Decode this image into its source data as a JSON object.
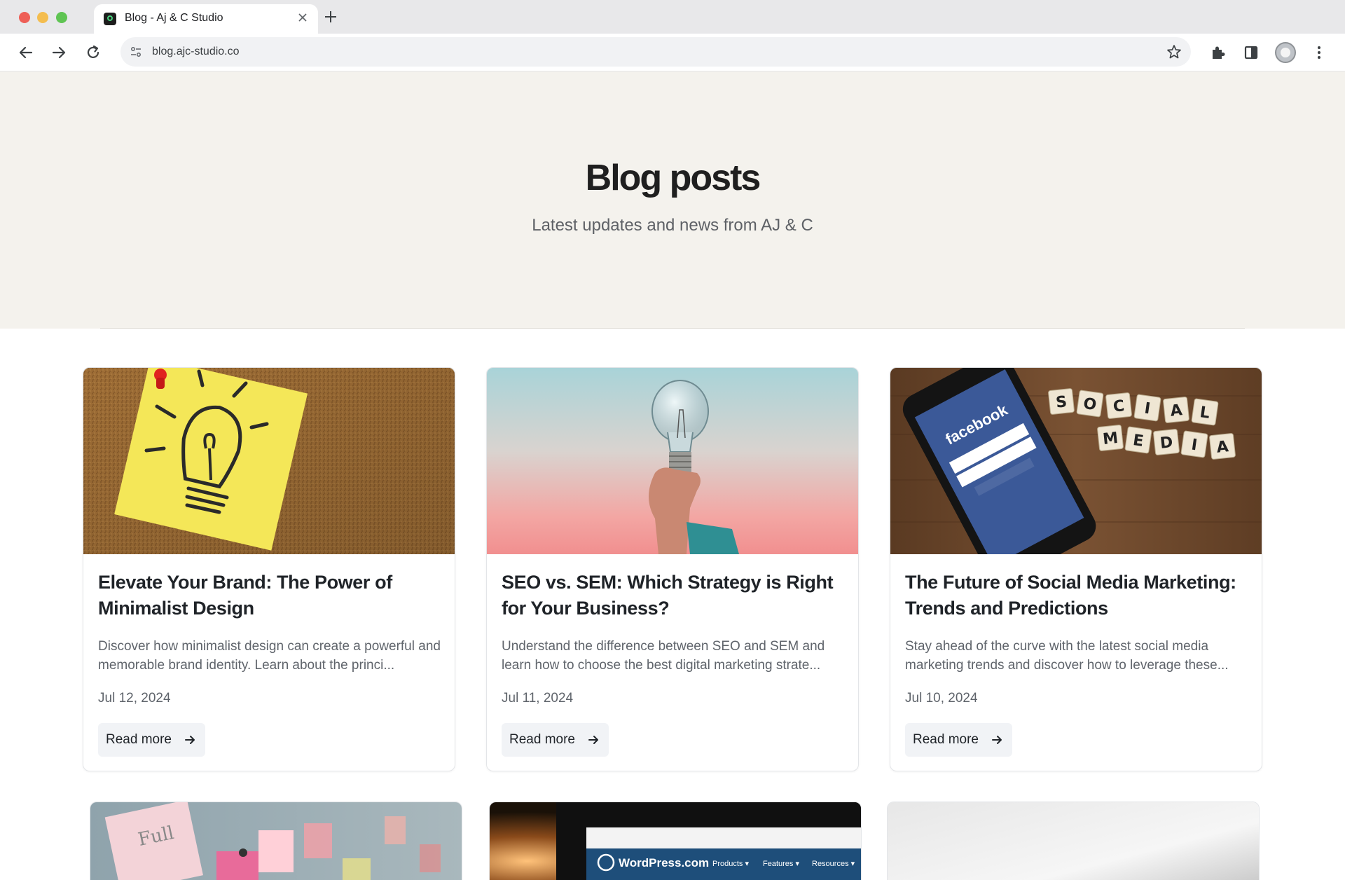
{
  "browser": {
    "tab_title": "Blog - Aj & C Studio",
    "url": "blog.ajc-studio.co"
  },
  "hero": {
    "title": "Blog posts",
    "subtitle": "Latest updates and news from AJ & C"
  },
  "posts": [
    {
      "title": "Elevate Your Brand: The Power of Minimalist Design",
      "excerpt": "Discover how minimalist design can create a powerful and memorable brand identity. Learn about the princi...",
      "date": "Jul 12, 2024",
      "cta": "Read more",
      "image": "sticky-note-lightbulb"
    },
    {
      "title": "SEO vs. SEM: Which Strategy is Right for Your Business?",
      "excerpt": "Understand the difference between SEO and SEM and learn how to choose the best digital marketing strate...",
      "date": "Jul 11, 2024",
      "cta": "Read more",
      "image": "hand-holding-lightbulb"
    },
    {
      "title": "The Future of Social Media Marketing: Trends and Predictions",
      "excerpt": "Stay ahead of the curve with the latest social media marketing trends and discover how to leverage these...",
      "date": "Jul 10, 2024",
      "cta": "Read more",
      "image": "phone-facebook-social-media-tiles"
    }
  ],
  "image_text": {
    "facebook": "facebook",
    "tiles_row1": [
      "S",
      "O",
      "C",
      "I",
      "A",
      "L"
    ],
    "tiles_row2": [
      "M",
      "E",
      "D",
      "I",
      "A"
    ],
    "sticky_note": "Full",
    "wordpress_logo": "WordPress.com",
    "wordpress_nav": [
      "Products ▾",
      "Features ▾",
      "Resources ▾"
    ]
  },
  "colors": {
    "hero_bg": "#f4f2ed",
    "button_bg": "#f1f3f6",
    "text_primary": "#1f2328",
    "text_secondary": "#5f646b"
  }
}
